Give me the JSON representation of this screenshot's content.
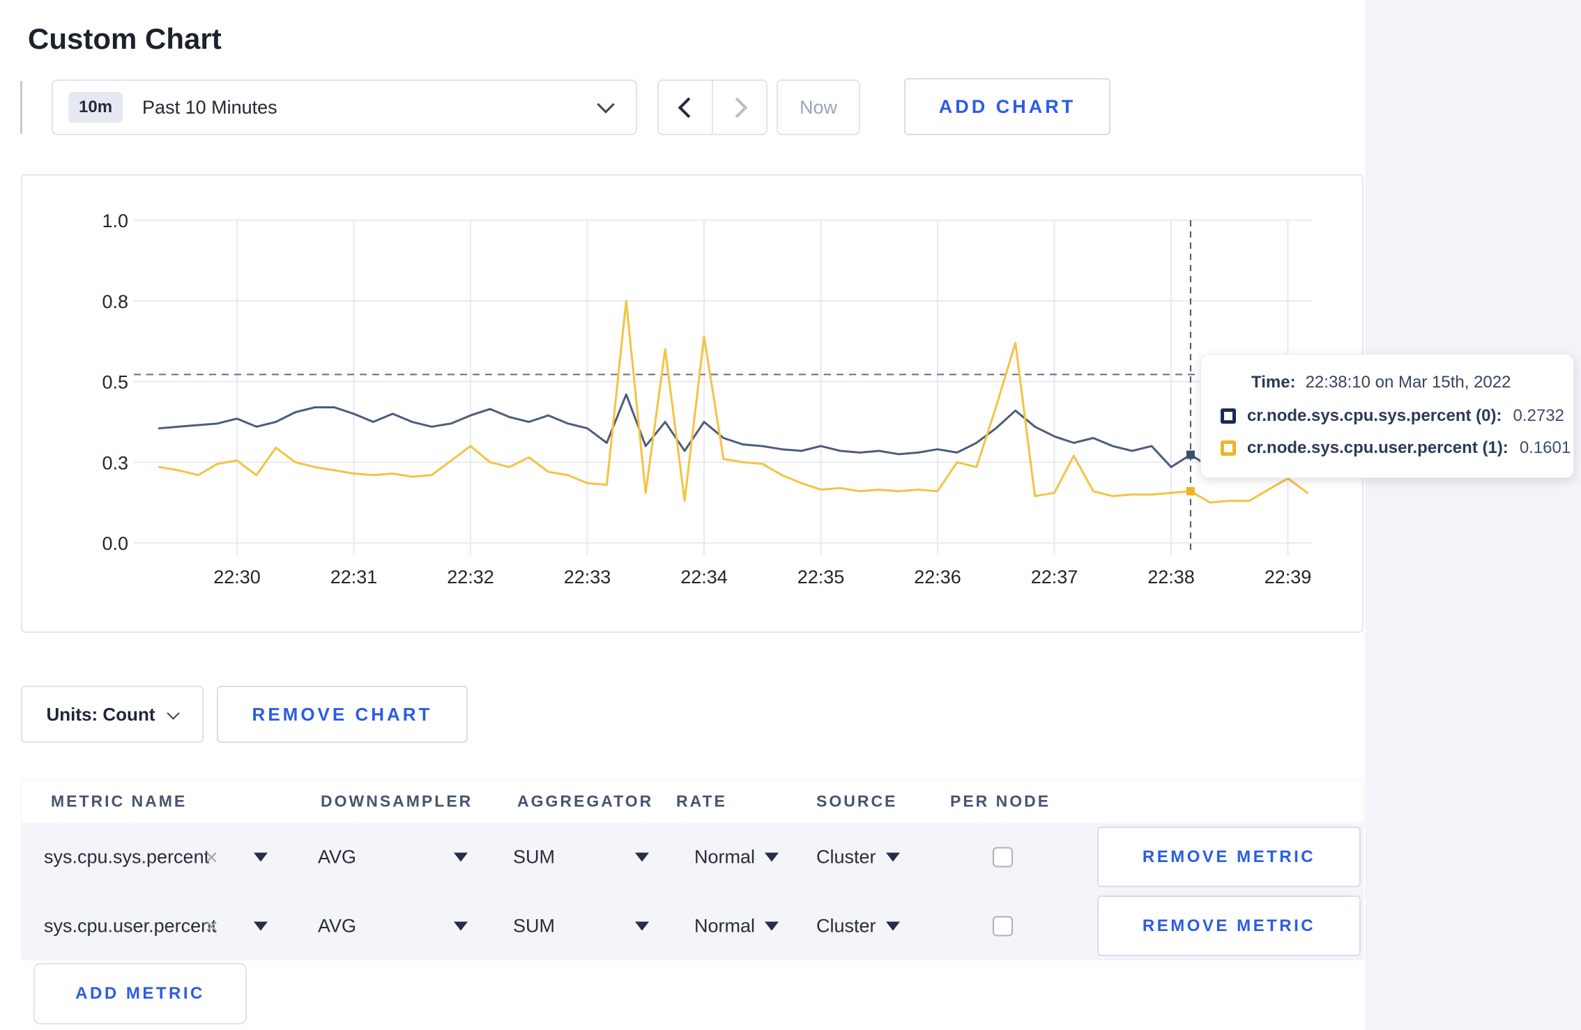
{
  "title": "Custom Chart",
  "colors": {
    "accent_blue": "#2b5ce2",
    "page_gutter": "#f2f4f8",
    "row_background": "#f4f5f9"
  },
  "icons": {
    "clear": "×"
  },
  "toolbar": {
    "time_range": {
      "badge": "10m",
      "label": "Past 10 Minutes"
    },
    "now_label": "Now",
    "add_chart_label": "ADD CHART"
  },
  "chart_data": {
    "type": "line",
    "title": "",
    "xlabel": "",
    "ylabel": "",
    "grid": true,
    "legend_position": "none",
    "y_axis": {
      "domain": [
        0,
        1.0
      ],
      "tick_values": [
        0,
        0.25,
        0.5,
        0.75,
        1.0
      ],
      "tick_labels": [
        "0.0",
        "0.3",
        "0.5",
        "0.8",
        "1.0"
      ]
    },
    "x_axis": {
      "tick_labels": [
        "22:30",
        "22:31",
        "22:32",
        "22:33",
        "22:34",
        "22:35",
        "22:36",
        "22:37",
        "22:38",
        "22:39"
      ]
    },
    "guide_line_value": 0.522,
    "series_start_offset_minutes": -0.6667,
    "interval_seconds": 10,
    "series": [
      {
        "id": "sys",
        "name": "cr.node.sys.cpu.sys.percent (0)",
        "color": "#4d5c7c",
        "swatch_color": "#1d2c50",
        "dot_color": "#3d4d70",
        "values": [
          0.355,
          0.36,
          0.365,
          0.37,
          0.385,
          0.36,
          0.375,
          0.405,
          0.42,
          0.42,
          0.4,
          0.375,
          0.4,
          0.375,
          0.36,
          0.37,
          0.395,
          0.415,
          0.39,
          0.375,
          0.395,
          0.37,
          0.355,
          0.31,
          0.46,
          0.3,
          0.375,
          0.285,
          0.375,
          0.325,
          0.305,
          0.3,
          0.29,
          0.285,
          0.3,
          0.285,
          0.28,
          0.285,
          0.275,
          0.28,
          0.29,
          0.28,
          0.31,
          0.355,
          0.41,
          0.36,
          0.33,
          0.31,
          0.325,
          0.3,
          0.285,
          0.3,
          0.235,
          0.2732,
          0.235,
          0.245,
          0.27,
          0.26,
          0.27,
          0.285
        ]
      },
      {
        "id": "user",
        "name": "cr.node.sys.cpu.user.percent (1)",
        "color": "#f5c342",
        "swatch_color": "#f0b429",
        "dot_color": "#f0b429",
        "values": [
          0.235,
          0.225,
          0.21,
          0.245,
          0.255,
          0.21,
          0.295,
          0.25,
          0.235,
          0.225,
          0.215,
          0.21,
          0.215,
          0.205,
          0.21,
          0.255,
          0.3,
          0.25,
          0.235,
          0.265,
          0.22,
          0.21,
          0.185,
          0.18,
          0.75,
          0.155,
          0.6,
          0.13,
          0.64,
          0.26,
          0.25,
          0.245,
          0.21,
          0.185,
          0.165,
          0.17,
          0.16,
          0.165,
          0.16,
          0.165,
          0.16,
          0.25,
          0.235,
          0.42,
          0.62,
          0.145,
          0.155,
          0.27,
          0.16,
          0.145,
          0.15,
          0.15,
          0.155,
          0.1601,
          0.125,
          0.13,
          0.13,
          0.165,
          0.2,
          0.155
        ]
      }
    ],
    "crosshair": {
      "offset_minutes": 8.1667,
      "time": "22:38:10",
      "values": [
        0.2732,
        0.1601
      ]
    }
  },
  "tooltip": {
    "time_label": "Time:",
    "time_value": "22:38:10 on Mar 15th, 2022",
    "series": [
      {
        "name": "cr.node.sys.cpu.sys.percent (0):",
        "value": "0.2732"
      },
      {
        "name": "cr.node.sys.cpu.user.percent (1):",
        "value": "0.1601"
      }
    ]
  },
  "units_label": "Units: Count",
  "remove_chart_label": "REMOVE CHART",
  "metrics": {
    "headers": [
      "METRIC NAME",
      "DOWNSAMPLER",
      "AGGREGATOR",
      "RATE",
      "SOURCE",
      "PER NODE"
    ],
    "remove_label": "REMOVE METRIC",
    "add_label": "ADD METRIC",
    "rows": [
      {
        "metric": "sys.cpu.sys.percent",
        "downsampler": "AVG",
        "aggregator": "SUM",
        "rate": "Normal",
        "source": "Cluster",
        "per_node": false
      },
      {
        "metric": "sys.cpu.user.percent",
        "downsampler": "AVG",
        "aggregator": "SUM",
        "rate": "Normal",
        "source": "Cluster",
        "per_node": false
      }
    ]
  }
}
